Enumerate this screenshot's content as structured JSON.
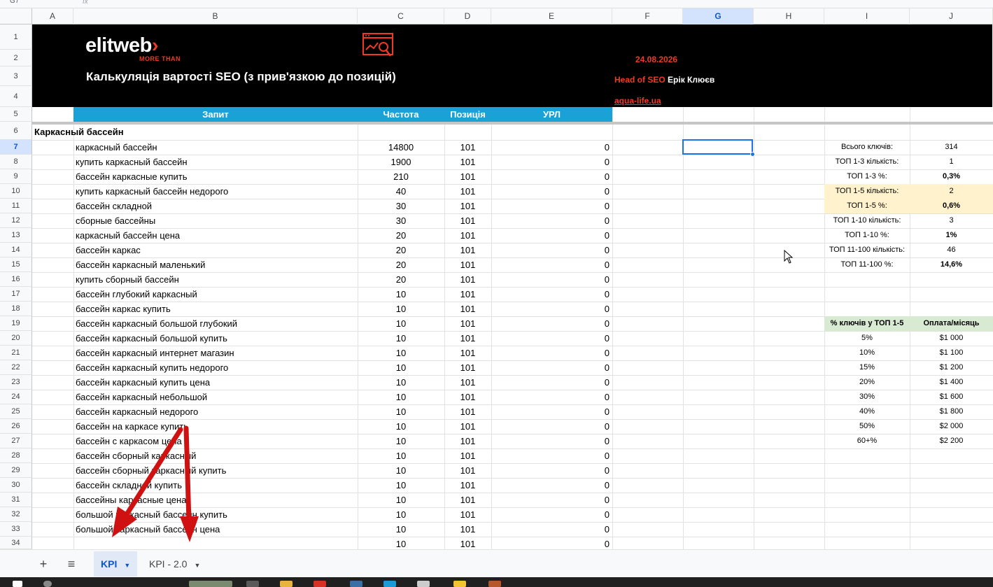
{
  "toolbar": {
    "name_box": "G7",
    "fx_symbol": "fx"
  },
  "columns": [
    "A",
    "B",
    "C",
    "D",
    "E",
    "F",
    "G",
    "H",
    "I",
    "J"
  ],
  "selected_column": "G",
  "selected_row": "7",
  "rows": [
    "1",
    "2",
    "3",
    "4",
    "5",
    "6",
    "7",
    "8",
    "9",
    "10",
    "11",
    "12",
    "13",
    "14",
    "15",
    "16",
    "17",
    "18",
    "19",
    "20",
    "21",
    "22",
    "23",
    "24",
    "25",
    "26",
    "27",
    "28",
    "29",
    "30",
    "31",
    "32",
    "33",
    "34"
  ],
  "banner": {
    "logo_text": "elitweb",
    "logo_arrow": "›",
    "logo_tagline": "MORE THAN",
    "title": "Калькуляція вартості SEO (з прив'язкою до позицій)",
    "date": "24.08.2026",
    "role": "Head of SEO",
    "name": "Ерік Клюєв",
    "site": "aqua-life.ua",
    "icon": "analytics-magnifier-icon"
  },
  "table_header": {
    "query": "Запит",
    "frequency": "Частота",
    "position": "Позиція",
    "url": "УРЛ"
  },
  "section_title": "Каркасный бассейн",
  "keywords": [
    {
      "q": "каркасный бассейн",
      "f": "14800",
      "p": "101",
      "u": "0"
    },
    {
      "q": "купить каркасный бассейн",
      "f": "1900",
      "p": "101",
      "u": "0"
    },
    {
      "q": "бассейн каркасные купить",
      "f": "210",
      "p": "101",
      "u": "0"
    },
    {
      "q": "купить каркасный бассейн недорого",
      "f": "40",
      "p": "101",
      "u": "0"
    },
    {
      "q": "бассейн складной",
      "f": "30",
      "p": "101",
      "u": "0"
    },
    {
      "q": "сборные бассейны",
      "f": "30",
      "p": "101",
      "u": "0"
    },
    {
      "q": "каркасный бассейн цена",
      "f": "20",
      "p": "101",
      "u": "0"
    },
    {
      "q": "бассейн каркас",
      "f": "20",
      "p": "101",
      "u": "0"
    },
    {
      "q": "бассейн каркасный маленький",
      "f": "20",
      "p": "101",
      "u": "0"
    },
    {
      "q": "купить сборный бассейн",
      "f": "20",
      "p": "101",
      "u": "0"
    },
    {
      "q": "бассейн глубокий каркасный",
      "f": "10",
      "p": "101",
      "u": "0"
    },
    {
      "q": "бассейн каркас купить",
      "f": "10",
      "p": "101",
      "u": "0"
    },
    {
      "q": "бассейн каркасный большой глубокий",
      "f": "10",
      "p": "101",
      "u": "0"
    },
    {
      "q": "бассейн каркасный большой купить",
      "f": "10",
      "p": "101",
      "u": "0"
    },
    {
      "q": "бассейн каркасный интернет магазин",
      "f": "10",
      "p": "101",
      "u": "0"
    },
    {
      "q": "бассейн каркасный купить недорого",
      "f": "10",
      "p": "101",
      "u": "0"
    },
    {
      "q": "бассейн каркасный купить цена",
      "f": "10",
      "p": "101",
      "u": "0"
    },
    {
      "q": "бассейн каркасный небольшой",
      "f": "10",
      "p": "101",
      "u": "0"
    },
    {
      "q": "бассейн каркасный недорого",
      "f": "10",
      "p": "101",
      "u": "0"
    },
    {
      "q": "бассейн на каркасе купить",
      "f": "10",
      "p": "101",
      "u": "0"
    },
    {
      "q": "бассейн с каркасом цена",
      "f": "10",
      "p": "101",
      "u": "0"
    },
    {
      "q": "бассейн сборный каркасный",
      "f": "10",
      "p": "101",
      "u": "0"
    },
    {
      "q": "бассейн сборный каркасный купить",
      "f": "10",
      "p": "101",
      "u": "0"
    },
    {
      "q": "бассейн складной купить",
      "f": "10",
      "p": "101",
      "u": "0"
    },
    {
      "q": "бассейны каркасные цена",
      "f": "10",
      "p": "101",
      "u": "0"
    },
    {
      "q": "большой каркасный бассейн купить",
      "f": "10",
      "p": "101",
      "u": "0"
    },
    {
      "q": "большой каркасный бассейн цена",
      "f": "10",
      "p": "101",
      "u": "0"
    },
    {
      "q": "",
      "f": "10",
      "p": "101",
      "u": "0"
    }
  ],
  "stats": [
    {
      "label": "Всього ключів:",
      "value": "314",
      "bold": false,
      "hl": false
    },
    {
      "label": "ТОП 1-3 кількість:",
      "value": "1",
      "bold": false,
      "hl": false
    },
    {
      "label": "ТОП 1-3 %:",
      "value": "0,3%",
      "bold": true,
      "hl": false
    },
    {
      "label": "ТОП 1-5 кількість:",
      "value": "2",
      "bold": false,
      "hl": true
    },
    {
      "label": "ТОП 1-5 %:",
      "value": "0,6%",
      "bold": true,
      "hl": true
    },
    {
      "label": "ТОП 1-10 кількість:",
      "value": "3",
      "bold": false,
      "hl": false
    },
    {
      "label": "ТОП 1-10 %:",
      "value": "1%",
      "bold": true,
      "hl": false
    },
    {
      "label": "ТОП 11-100 кількість:",
      "value": "46",
      "bold": false,
      "hl": false
    },
    {
      "label": "ТОП 11-100 %:",
      "value": "14,6%",
      "bold": true,
      "hl": false
    }
  ],
  "pricing": {
    "header_pct": "% ключів у ТОП 1-5",
    "header_pay": "Оплата/місяць",
    "rows": [
      {
        "pct": "5%",
        "pay": "$1 000"
      },
      {
        "pct": "10%",
        "pay": "$1 100"
      },
      {
        "pct": "15%",
        "pay": "$1 200"
      },
      {
        "pct": "20%",
        "pay": "$1 400"
      },
      {
        "pct": "30%",
        "pay": "$1 600"
      },
      {
        "pct": "40%",
        "pay": "$1 800"
      },
      {
        "pct": "50%",
        "pay": "$2 000"
      },
      {
        "pct": "60+%",
        "pay": "$2 200"
      }
    ]
  },
  "tabs": {
    "add_icon": "+",
    "menu_icon": "≡",
    "items": [
      {
        "label": "KPI",
        "active": true
      },
      {
        "label": "KPI - 2.0",
        "active": false
      }
    ]
  },
  "colors": {
    "banner_bg": "#000000",
    "accent": "#ee3a24",
    "header_blue": "#1aa1d6",
    "highlight_yellow": "#fff2cc",
    "highlight_green": "#d9ead3",
    "selection": "#1a73e8",
    "annotation_arrow": "#d01111"
  }
}
